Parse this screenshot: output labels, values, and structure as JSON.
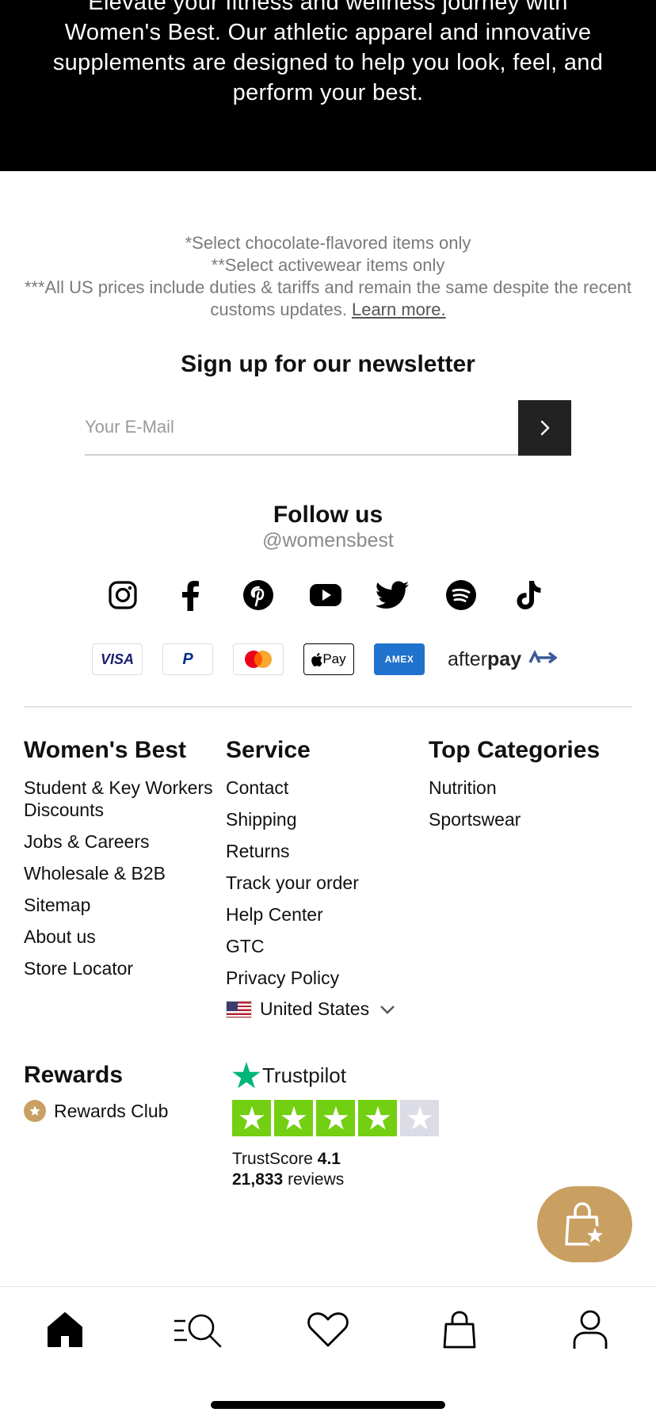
{
  "hero": {
    "text": "Elevate your fitness and wellness journey with Women's Best. Our athletic apparel and innovative supplements are designed to help you look, feel, and perform your best."
  },
  "notes": {
    "line1": "*Select chocolate-flavored items only",
    "line2": "**Select activewear items only",
    "line3": "***All US prices include duties & tariffs and remain the same despite the recent customs updates.",
    "learn_more": "Learn more."
  },
  "newsletter": {
    "title": "Sign up for our newsletter",
    "placeholder": "Your E-Mail",
    "submit_icon": "chevron-right-icon"
  },
  "follow": {
    "title": "Follow us",
    "handle": "@womensbest",
    "icons": [
      "instagram-icon",
      "facebook-icon",
      "pinterest-icon",
      "youtube-icon",
      "twitter-icon",
      "spotify-icon",
      "tiktok-icon"
    ]
  },
  "payments": {
    "visa": "VISA",
    "paypal": "P",
    "applepay": "Pay",
    "amex": "AMEX",
    "afterpay_prefix": "after",
    "afterpay_bold": "pay"
  },
  "footer": {
    "col1": {
      "title": "Women's Best",
      "items": [
        "Student & Key Workers Discounts",
        "Jobs & Careers",
        "Wholesale & B2B",
        "Sitemap",
        "About us",
        "Store Locator"
      ]
    },
    "col2": {
      "title": "Service",
      "items": [
        "Contact",
        "Shipping",
        "Returns",
        "Track your order",
        "Help Center",
        "GTC",
        "Privacy Policy"
      ],
      "country": "United States"
    },
    "col3": {
      "title": "Top Categories",
      "items": [
        "Nutrition",
        "Sportswear"
      ]
    }
  },
  "rewards": {
    "title": "Rewards",
    "item": "Rewards Club"
  },
  "trustpilot": {
    "brand": "Trustpilot",
    "score_label": "TrustScore",
    "score": "4.1",
    "reviews_count": "21,833",
    "reviews_label": "reviews",
    "stars": 4.1
  },
  "colors": {
    "accent_gold": "#c9a062",
    "trustpilot_green": "#00b67a",
    "star_green": "#73cf11"
  },
  "tabbar": {
    "icons": [
      "home-icon",
      "search-menu-icon",
      "heart-icon",
      "bag-icon",
      "account-icon"
    ]
  }
}
